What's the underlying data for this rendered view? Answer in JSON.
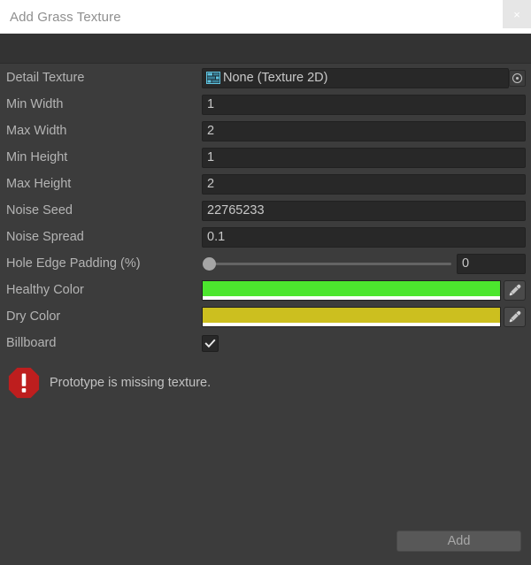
{
  "window": {
    "title": "Add Grass Texture",
    "close_label": "×",
    "close_icon": "close-icon"
  },
  "form": {
    "rows": [
      {
        "label": "Detail Texture",
        "type": "object",
        "value": "None (Texture 2D)",
        "icon": "texture-2d-icon",
        "picker_icon": "object-picker-icon"
      },
      {
        "label": "Min Width",
        "type": "text",
        "value": "1"
      },
      {
        "label": "Max Width",
        "type": "text",
        "value": "2"
      },
      {
        "label": "Min Height",
        "type": "text",
        "value": "1"
      },
      {
        "label": "Max Height",
        "type": "text",
        "value": "2"
      },
      {
        "label": "Noise Seed",
        "type": "text",
        "value": "22765233"
      },
      {
        "label": "Noise Spread",
        "type": "text",
        "value": "0.1"
      },
      {
        "label": "Hole Edge Padding (%)",
        "type": "slider",
        "value": "0",
        "slider_percent": 0,
        "slider_min": 0,
        "slider_max": 100
      },
      {
        "label": "Healthy Color",
        "type": "color",
        "value": "#4CE62E",
        "alpha_color": "#FFFFFF",
        "eyedropper_icon": "eyedropper-icon"
      },
      {
        "label": "Dry Color",
        "type": "color",
        "value": "#CCBF1F",
        "alpha_color": "#FFFFFF",
        "eyedropper_icon": "eyedropper-icon"
      },
      {
        "label": "Billboard",
        "type": "checkbox",
        "value": "✓",
        "checked": true
      }
    ]
  },
  "helpbox": {
    "icon": "error-icon",
    "text": "Prototype is missing texture.",
    "icon_color": "#BE1E1E"
  },
  "footer": {
    "add_label": "Add"
  }
}
